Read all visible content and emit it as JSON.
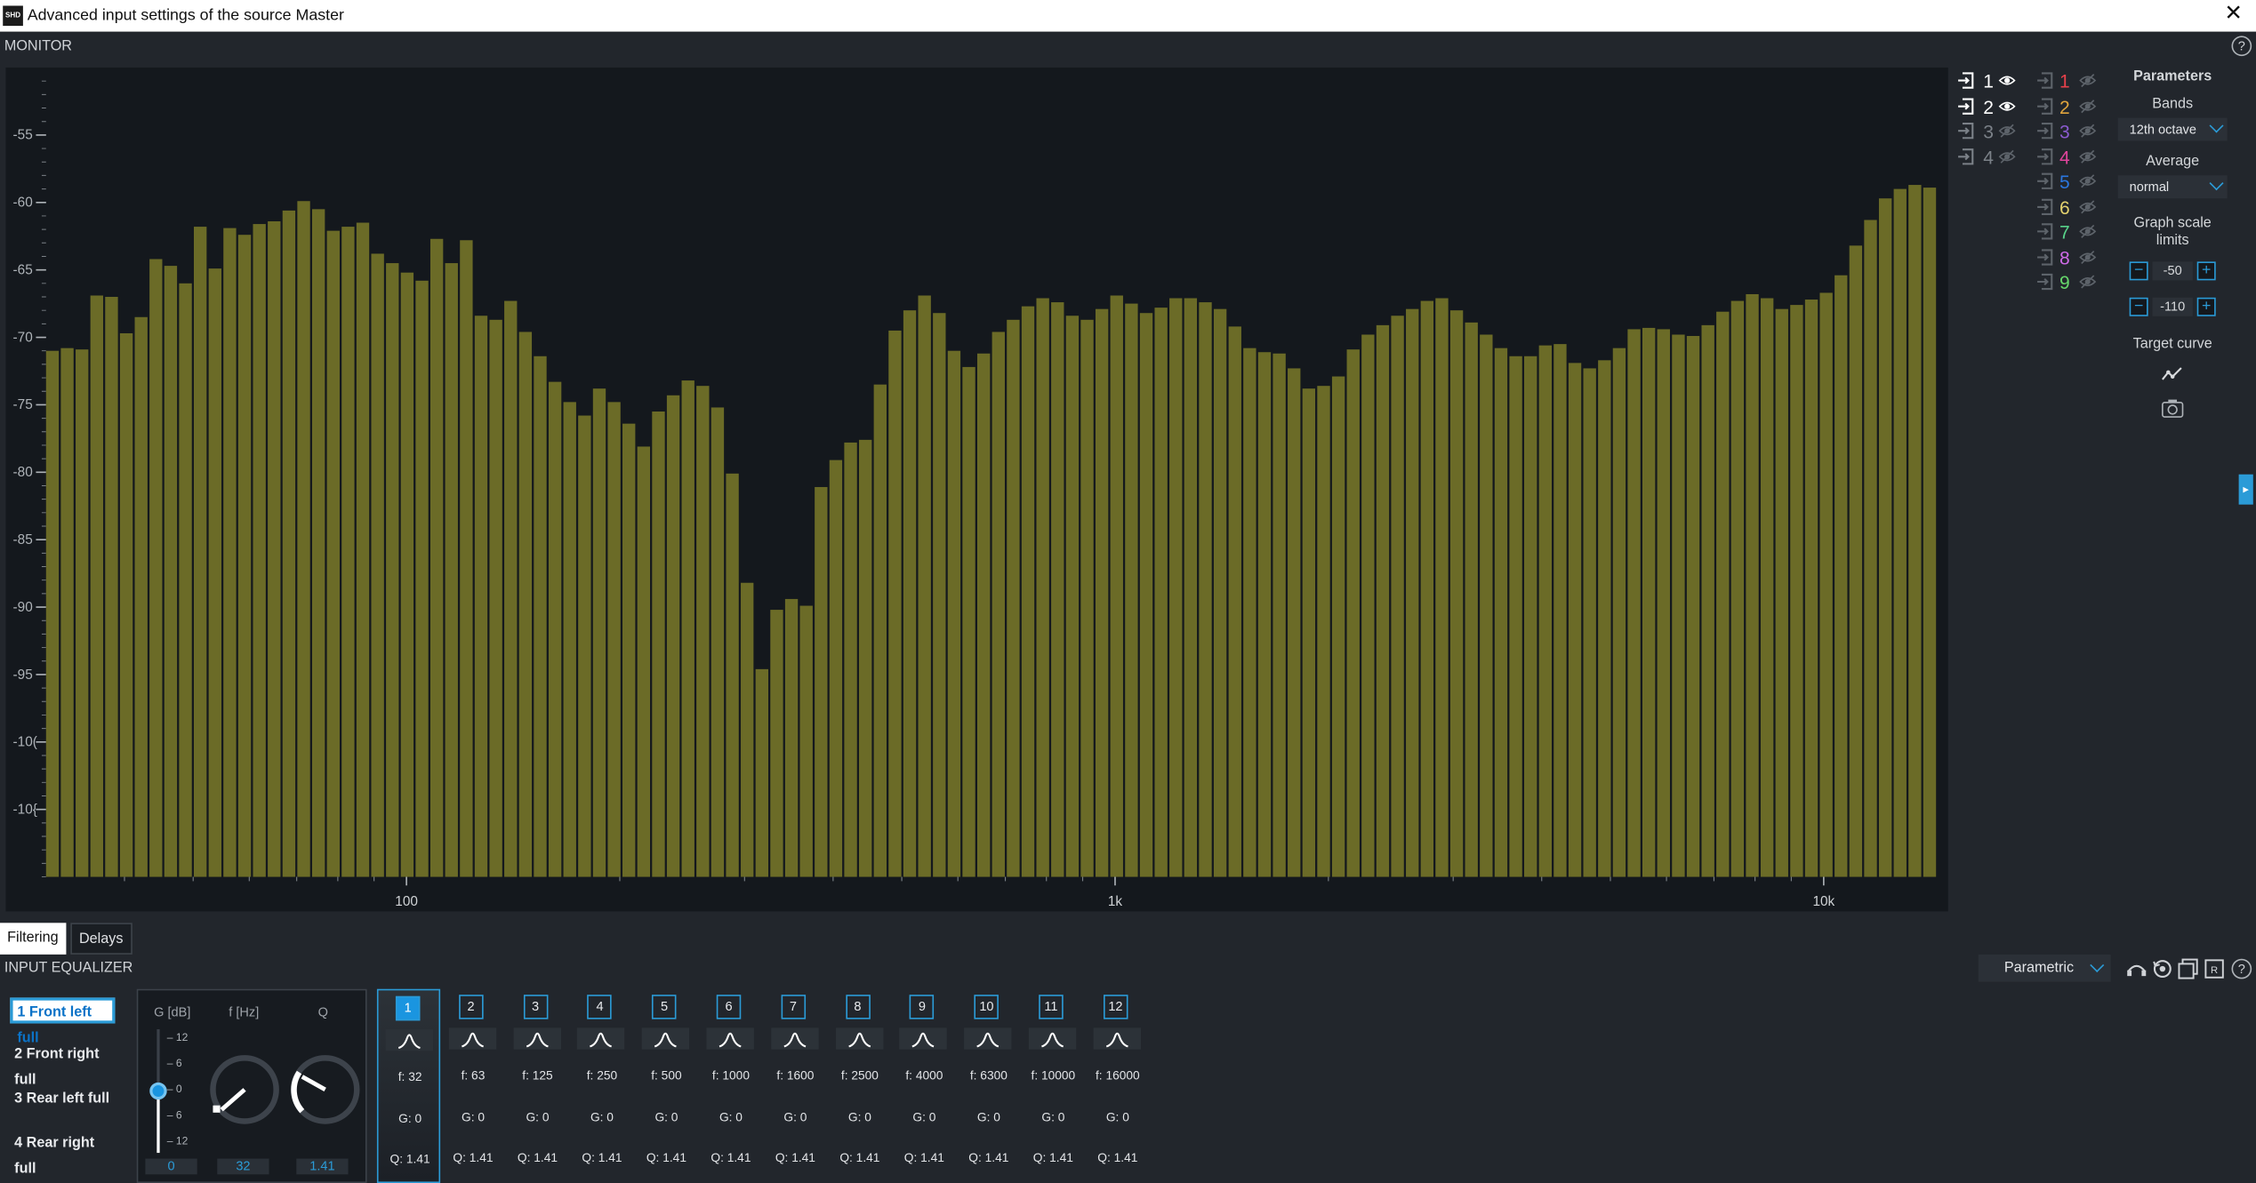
{
  "window": {
    "title": "Advanced input settings of the source Master",
    "logo": "SHD",
    "close": "✕"
  },
  "monitor": {
    "title": "MONITOR",
    "help": "?"
  },
  "chart_data": {
    "type": "bar",
    "title": "",
    "xlabel": "",
    "ylabel": "",
    "x_scale": "log",
    "xlim": [
      31,
      14500
    ],
    "ylim": [
      -110,
      -50
    ],
    "grid": false,
    "y_ticks": [
      -55,
      -60,
      -65,
      -70,
      -75,
      -80,
      -85,
      -90,
      -95,
      -100,
      -105
    ],
    "y_tick_labels": [
      "-55",
      "-60",
      "-65",
      "-70",
      "-75",
      "-80",
      "-85",
      "-90",
      "-95",
      "-10(",
      "-10{"
    ],
    "x_tick_labels": [
      {
        "value": 100,
        "label": "100"
      },
      {
        "value": 1000,
        "label": "1k"
      },
      {
        "value": 10000,
        "label": "10k"
      }
    ],
    "bar_color": "#6b6b27",
    "band_resolution": "12th octave",
    "values": [
      -71,
      -70.8,
      -70.9,
      -66.9,
      -67,
      -69.7,
      -68.5,
      -64.2,
      -64.7,
      -66,
      -61.8,
      -64.9,
      -61.9,
      -62.4,
      -61.6,
      -61.4,
      -60.6,
      -59.9,
      -60.5,
      -62.1,
      -61.8,
      -61.5,
      -63.8,
      -64.5,
      -65.2,
      -65.8,
      -62.7,
      -64.5,
      -62.8,
      -68.4,
      -68.7,
      -67.3,
      -69.6,
      -71.4,
      -73.3,
      -74.8,
      -75.8,
      -73.8,
      -74.8,
      -76.4,
      -78.1,
      -75.5,
      -74.3,
      -73.2,
      -73.6,
      -75.2,
      -80.1,
      -88.2,
      -94.6,
      -90.2,
      -89.4,
      -89.9,
      -81.1,
      -79.1,
      -77.8,
      -77.6,
      -73.5,
      -69.5,
      -68,
      -66.9,
      -68.2,
      -71,
      -72.2,
      -71.2,
      -69.6,
      -68.7,
      -67.7,
      -67.1,
      -67.4,
      -68.4,
      -68.7,
      -67.9,
      -66.9,
      -67.5,
      -68.2,
      -67.8,
      -67.1,
      -67.1,
      -67.4,
      -67.9,
      -69.2,
      -70.8,
      -71.1,
      -71.2,
      -72.3,
      -73.8,
      -73.6,
      -72.9,
      -70.9,
      -69.8,
      -69.1,
      -68.4,
      -67.9,
      -67.3,
      -67.1,
      -68,
      -68.9,
      -69.8,
      -70.8,
      -71.4,
      -71.4,
      -70.6,
      -70.5,
      -71.9,
      -72.3,
      -71.7,
      -70.8,
      -69.4,
      -69.3,
      -69.4,
      -69.8,
      -69.9,
      -69.1,
      -68.1,
      -67.3,
      -66.8,
      -67.1,
      -67.9,
      -67.6,
      -67.2,
      -66.7,
      -65.4,
      -63.2,
      -61.3,
      -59.7,
      -59,
      -58.7,
      -58.9
    ]
  },
  "sources": {
    "inputs": [
      {
        "num": "1",
        "visible": true,
        "icon": "eye-icon"
      },
      {
        "num": "2",
        "visible": true,
        "icon": "eye-icon"
      },
      {
        "num": "3",
        "visible": false,
        "icon": "eye-off-icon"
      },
      {
        "num": "4",
        "visible": false,
        "icon": "eye-off-icon"
      }
    ],
    "outputs": [
      {
        "num": "1",
        "color": "#e8414b",
        "visible": false
      },
      {
        "num": "2",
        "color": "#e0a53d",
        "visible": false
      },
      {
        "num": "3",
        "color": "#8b5bd0",
        "visible": false
      },
      {
        "num": "4",
        "color": "#e0449c",
        "visible": false
      },
      {
        "num": "5",
        "color": "#2b77e0",
        "visible": false
      },
      {
        "num": "6",
        "color": "#e3d26e",
        "visible": false
      },
      {
        "num": "7",
        "color": "#58d38a",
        "visible": false
      },
      {
        "num": "8",
        "color": "#cf6be8",
        "visible": false
      },
      {
        "num": "9",
        "color": "#66d66b",
        "visible": false
      }
    ]
  },
  "parameters": {
    "title": "Parameters",
    "bands_label": "Bands",
    "bands_value": "12th octave",
    "average_label": "Average",
    "average_value": "normal",
    "scale_label": "Graph scale limits",
    "scale_max": "-50",
    "scale_min": "-110",
    "minus": "−",
    "plus": "+",
    "target_label": "Target curve"
  },
  "tabs": [
    {
      "label": "Filtering",
      "active": true
    },
    {
      "label": "Delays",
      "active": false
    }
  ],
  "equalizer": {
    "title": "INPUT EQUALIZER",
    "mode": "Parametric",
    "speakers": [
      {
        "label": "1  Front left full",
        "selected": true
      },
      {
        "label": "2  Front right full",
        "selected": false
      },
      {
        "label": "3  Rear left full",
        "selected": false
      },
      {
        "label": "4  Rear right full",
        "selected": false
      }
    ],
    "controls": {
      "gain_label": "G [dB]",
      "freq_label": "f [Hz]",
      "q_label": "Q",
      "scale": [
        "12",
        "6",
        "0",
        "6",
        "12"
      ],
      "gain_value": "0",
      "freq_value": "32",
      "q_value": "1.41"
    },
    "bands": [
      {
        "num": "1",
        "f": "f: 32",
        "g": "G: 0",
        "q": "Q: 1.41"
      },
      {
        "num": "2",
        "f": "f: 63",
        "g": "G: 0",
        "q": "Q: 1.41"
      },
      {
        "num": "3",
        "f": "f: 125",
        "g": "G: 0",
        "q": "Q: 1.41"
      },
      {
        "num": "4",
        "f": "f: 250",
        "g": "G: 0",
        "q": "Q: 1.41"
      },
      {
        "num": "5",
        "f": "f: 500",
        "g": "G: 0",
        "q": "Q: 1.41"
      },
      {
        "num": "6",
        "f": "f: 1000",
        "g": "G: 0",
        "q": "Q: 1.41"
      },
      {
        "num": "7",
        "f": "f: 1600",
        "g": "G: 0",
        "q": "Q: 1.41"
      },
      {
        "num": "8",
        "f": "f: 2500",
        "g": "G: 0",
        "q": "Q: 1.41"
      },
      {
        "num": "9",
        "f": "f: 4000",
        "g": "G: 0",
        "q": "Q: 1.41"
      },
      {
        "num": "10",
        "f": "f: 6300",
        "g": "G: 0",
        "q": "Q: 1.41"
      },
      {
        "num": "11",
        "f": "f: 10000",
        "g": "G: 0",
        "q": "Q: 1.41"
      },
      {
        "num": "12",
        "f": "f: 16000",
        "g": "G: 0",
        "q": "Q: 1.41"
      }
    ],
    "selected_band": "1"
  }
}
